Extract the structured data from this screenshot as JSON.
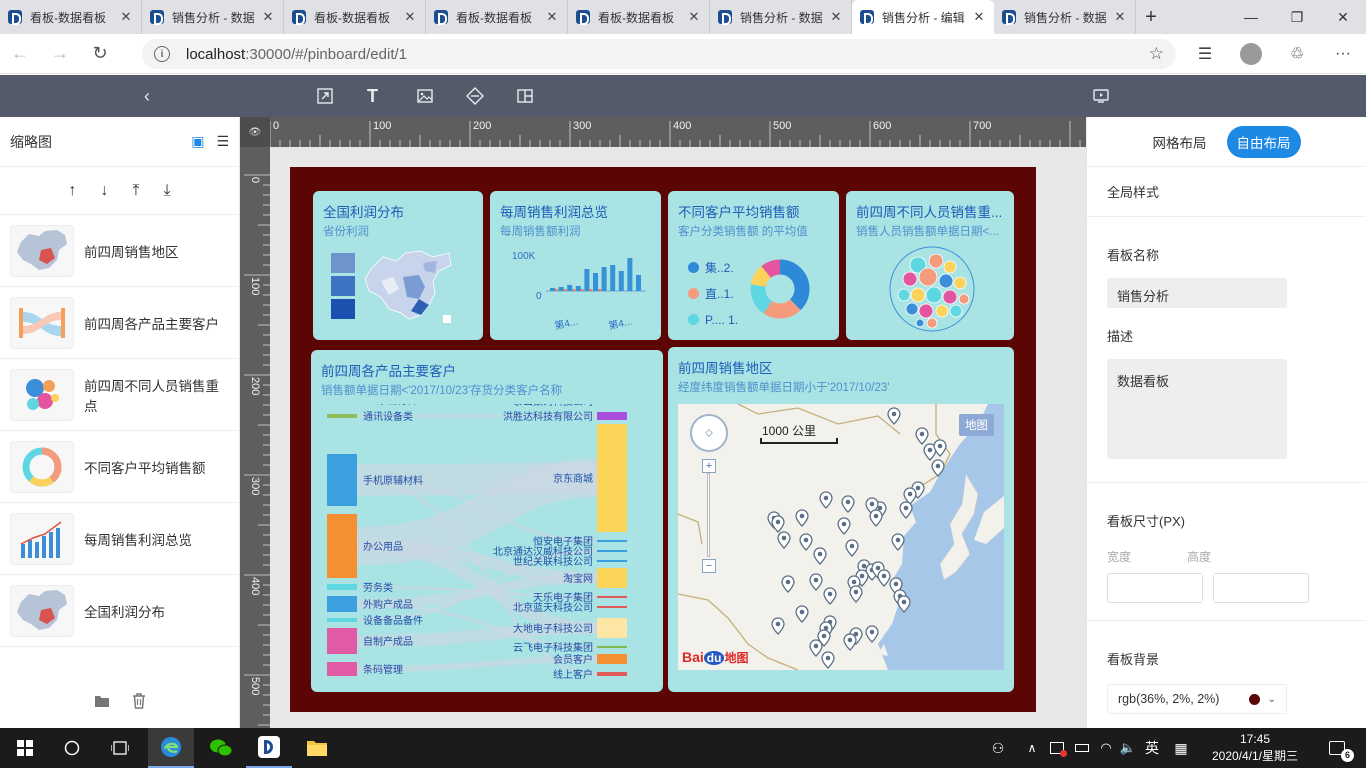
{
  "browser": {
    "tabs": [
      {
        "title": "看板-数据看板"
      },
      {
        "title": "销售分析 - 数据"
      },
      {
        "title": "看板-数据看板"
      },
      {
        "title": "看板-数据看板"
      },
      {
        "title": "看板-数据看板"
      },
      {
        "title": "销售分析 - 数据"
      },
      {
        "title": "销售分析 - 编辑"
      },
      {
        "title": "销售分析 - 数据"
      }
    ],
    "active_tab_index": 6,
    "url_host": "localhost",
    "url_path": ":30000/#/pinboard/edit/1"
  },
  "left_panel": {
    "title": "缩略图",
    "items": [
      {
        "label": "前四周销售地区",
        "thumb": "map"
      },
      {
        "label": "前四周各产品主要客户",
        "thumb": "sankey"
      },
      {
        "label": "前四周不同人员销售重点",
        "thumb": "bubble"
      },
      {
        "label": "不同客户平均销售额",
        "thumb": "donut"
      },
      {
        "label": "每周销售利润总览",
        "thumb": "bar"
      },
      {
        "label": "全国利润分布",
        "thumb": "map"
      }
    ]
  },
  "ruler": {
    "top_labels": [
      "0",
      "100",
      "200",
      "300",
      "400",
      "500",
      "600",
      "700"
    ],
    "left_labels": [
      "0",
      "100",
      "200",
      "300",
      "400",
      "500"
    ]
  },
  "cards": {
    "profit_map": {
      "title": "全国利润分布",
      "subtitle": "省份利润"
    },
    "weekly": {
      "title": "每周销售利润总览",
      "subtitle": "每周销售额利润",
      "y_top": "100K",
      "y_zero": "0",
      "x1": "第4...",
      "x2": "第4..."
    },
    "avg": {
      "title": "不同客户平均销售额",
      "subtitle": "客户分类销售额 的平均值",
      "legend": [
        "集..2.",
        "直..1.",
        "P.... 1."
      ]
    },
    "staff": {
      "title": "前四周不同人员销售重...",
      "subtitle": "销售人员销售额单据日期<..."
    },
    "sankey": {
      "title": "前四周各产品主要客户",
      "subtitle": "销售额单据日期<'2017/10/23'存货分类客户名称",
      "left_nodes": [
        "PC原辅材料",
        "通讯设备类",
        "手机原辅材料",
        "办公用品",
        "劳务类",
        "外购产成品",
        "设备备品备件",
        "自制产成品",
        "条码管理"
      ],
      "right_nodes": [
        "泰山数码科技公司",
        "洪胜达科技有限公司",
        "京东商城",
        "恒安电子集团",
        "北京通达汉威科技公司",
        "世纪关联科技公司",
        "淘宝网",
        "天乐电子集团",
        "北京蓝天科技公司",
        "大地电子科技公司",
        "云飞电子科技集团",
        "会员客户",
        "线上客户"
      ]
    },
    "region_map": {
      "title": "前四周销售地区",
      "subtitle": "经度纬度销售额单据日期小于'2017/10/23'",
      "scale": "1000 公里",
      "maptype": "地图",
      "logo_bai": "Bai",
      "logo_du": "du",
      "logo_map": "地图"
    }
  },
  "right_panel": {
    "layout_grid": "网格布局",
    "layout_free": "自由布局",
    "global_style": "全局样式",
    "name_label": "看板名称",
    "name_value": "销售分析",
    "desc_label": "描述",
    "desc_value": "数据看板",
    "size_label": "看板尺寸(PX)",
    "width_label": "宽度",
    "height_label": "高度",
    "bg_label": "看板背景",
    "bg_value": "rgb(36%, 2%, 2%)",
    "bg_color": "#5c0505"
  },
  "taskbar": {
    "time": "17:45",
    "date": "2020/4/1/星期三",
    "ime": "英",
    "notif_count": "6"
  },
  "colors": {
    "accent": "#1e88e5",
    "card_bg": "#a9e3e3",
    "toolbar": "#535b6b"
  }
}
